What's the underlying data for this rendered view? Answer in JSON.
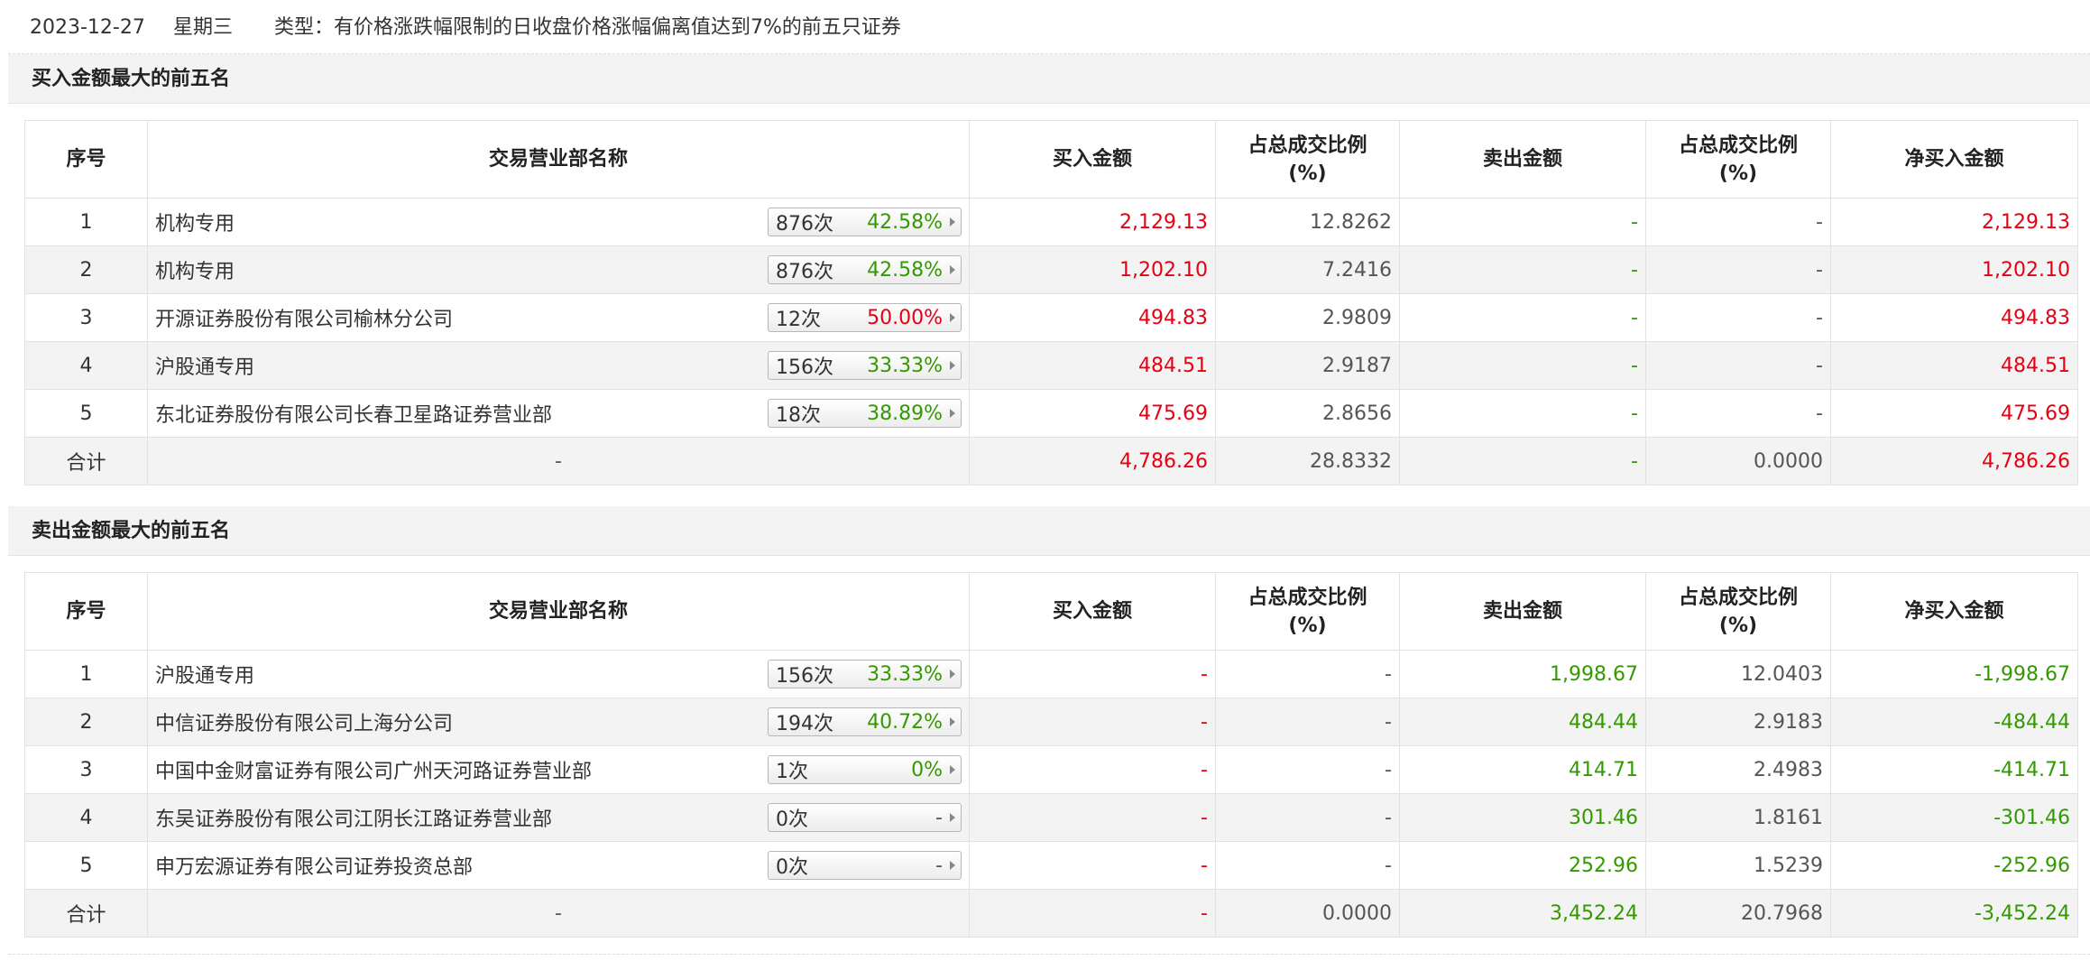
{
  "info": {
    "date": "2023-12-27",
    "weekday": "星期三",
    "type_text": "类型：有价格涨跌幅限制的日收盘价格涨幅偏离值达到7%的前五只证券"
  },
  "columns": {
    "idx": "序号",
    "dept": "交易营业部名称",
    "buy": "买入金额",
    "buy_ratio": "占总成交比例(%)",
    "sell": "卖出金额",
    "sell_ratio": "占总成交比例(%)",
    "net": "净买入金额"
  },
  "colors": {
    "up": "#e60012",
    "down": "#339900",
    "zebra": "#f3f3f3",
    "border": "#e2e2e2"
  },
  "icons": {
    "stat_arrow": "caret-right-icon"
  },
  "buy_section": {
    "title": "买入金额最大的前五名",
    "rows": [
      {
        "idx": "1",
        "dept": "机构专用",
        "times": "876次",
        "rate": "42.58%",
        "rate_color": "green",
        "buy": "2,129.13",
        "buy_ratio": "12.8262",
        "sell": "-",
        "sell_ratio": "-",
        "net": "2,129.13",
        "net_color": "red"
      },
      {
        "idx": "2",
        "dept": "机构专用",
        "times": "876次",
        "rate": "42.58%",
        "rate_color": "green",
        "buy": "1,202.10",
        "buy_ratio": "7.2416",
        "sell": "-",
        "sell_ratio": "-",
        "net": "1,202.10",
        "net_color": "red"
      },
      {
        "idx": "3",
        "dept": "开源证券股份有限公司榆林分公司",
        "times": "12次",
        "rate": "50.00%",
        "rate_color": "red",
        "buy": "494.83",
        "buy_ratio": "2.9809",
        "sell": "-",
        "sell_ratio": "-",
        "net": "494.83",
        "net_color": "red"
      },
      {
        "idx": "4",
        "dept": "沪股通专用",
        "times": "156次",
        "rate": "33.33%",
        "rate_color": "green",
        "buy": "484.51",
        "buy_ratio": "2.9187",
        "sell": "-",
        "sell_ratio": "-",
        "net": "484.51",
        "net_color": "red"
      },
      {
        "idx": "5",
        "dept": "东北证券股份有限公司长春卫星路证券营业部",
        "times": "18次",
        "rate": "38.89%",
        "rate_color": "green",
        "buy": "475.69",
        "buy_ratio": "2.8656",
        "sell": "-",
        "sell_ratio": "-",
        "net": "475.69",
        "net_color": "red"
      }
    ],
    "total": {
      "label": "合计",
      "dept": "-",
      "buy": "4,786.26",
      "buy_ratio": "28.8332",
      "sell": "-",
      "sell_ratio": "0.0000",
      "net": "4,786.26",
      "net_color": "red"
    }
  },
  "sell_section": {
    "title": "卖出金额最大的前五名",
    "rows": [
      {
        "idx": "1",
        "dept": "沪股通专用",
        "times": "156次",
        "rate": "33.33%",
        "rate_color": "green",
        "buy": "-",
        "buy_ratio": "-",
        "sell": "1,998.67",
        "sell_ratio": "12.0403",
        "net": "-1,998.67",
        "net_color": "green"
      },
      {
        "idx": "2",
        "dept": "中信证券股份有限公司上海分公司",
        "times": "194次",
        "rate": "40.72%",
        "rate_color": "green",
        "buy": "-",
        "buy_ratio": "-",
        "sell": "484.44",
        "sell_ratio": "2.9183",
        "net": "-484.44",
        "net_color": "green"
      },
      {
        "idx": "3",
        "dept": "中国中金财富证券有限公司广州天河路证券营业部",
        "times": "1次",
        "rate": "0%",
        "rate_color": "green",
        "buy": "-",
        "buy_ratio": "-",
        "sell": "414.71",
        "sell_ratio": "2.4983",
        "net": "-414.71",
        "net_color": "green"
      },
      {
        "idx": "4",
        "dept": "东吴证券股份有限公司江阴长江路证券营业部",
        "times": "0次",
        "rate": "-",
        "rate_color": "gray",
        "buy": "-",
        "buy_ratio": "-",
        "sell": "301.46",
        "sell_ratio": "1.8161",
        "net": "-301.46",
        "net_color": "green"
      },
      {
        "idx": "5",
        "dept": "申万宏源证券有限公司证券投资总部",
        "times": "0次",
        "rate": "-",
        "rate_color": "gray",
        "buy": "-",
        "buy_ratio": "-",
        "sell": "252.96",
        "sell_ratio": "1.5239",
        "net": "-252.96",
        "net_color": "green"
      }
    ],
    "total": {
      "label": "合计",
      "dept": "-",
      "buy": "-",
      "buy_ratio": "0.0000",
      "sell": "3,452.24",
      "sell_ratio": "20.7968",
      "net": "-3,452.24",
      "net_color": "green"
    }
  }
}
